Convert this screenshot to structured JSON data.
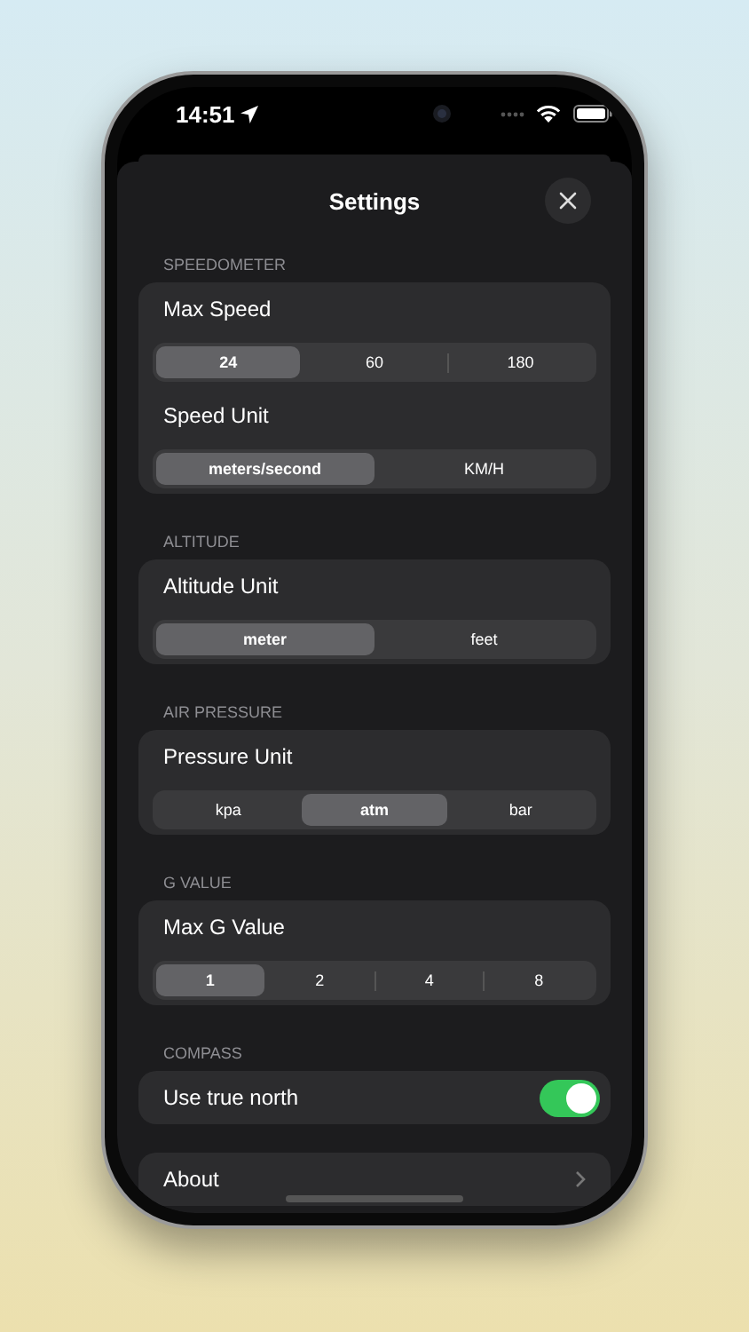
{
  "status_bar": {
    "time": "14:51"
  },
  "sheet": {
    "title": "Settings"
  },
  "sections": [
    {
      "title": "SPEEDOMETER",
      "rows": [
        {
          "kind": "segmented",
          "label": "Max Speed",
          "options": [
            {
              "label": "24",
              "selected": true
            },
            {
              "label": "60",
              "selected": false
            },
            {
              "label": "180",
              "selected": false
            }
          ]
        },
        {
          "kind": "segmented",
          "label": "Speed Unit",
          "options": [
            {
              "label": "meters/second",
              "selected": true
            },
            {
              "label": "KM/H",
              "selected": false
            }
          ]
        }
      ]
    },
    {
      "title": "ALTITUDE",
      "rows": [
        {
          "kind": "segmented",
          "label": "Altitude Unit",
          "options": [
            {
              "label": "meter",
              "selected": true
            },
            {
              "label": "feet",
              "selected": false
            }
          ]
        }
      ]
    },
    {
      "title": "AIR PRESSURE",
      "rows": [
        {
          "kind": "segmented",
          "label": "Pressure Unit",
          "options": [
            {
              "label": "kpa",
              "selected": false
            },
            {
              "label": "atm",
              "selected": true
            },
            {
              "label": "bar",
              "selected": false
            }
          ]
        }
      ]
    },
    {
      "title": "G VALUE",
      "rows": [
        {
          "kind": "segmented",
          "label": "Max G Value",
          "options": [
            {
              "label": "1",
              "selected": true
            },
            {
              "label": "2",
              "selected": false
            },
            {
              "label": "4",
              "selected": false
            },
            {
              "label": "8",
              "selected": false
            }
          ]
        }
      ]
    },
    {
      "title": "COMPASS",
      "rows": [
        {
          "kind": "toggle",
          "label": "Use true north",
          "on": true
        }
      ]
    }
  ],
  "about": {
    "label": "About"
  }
}
